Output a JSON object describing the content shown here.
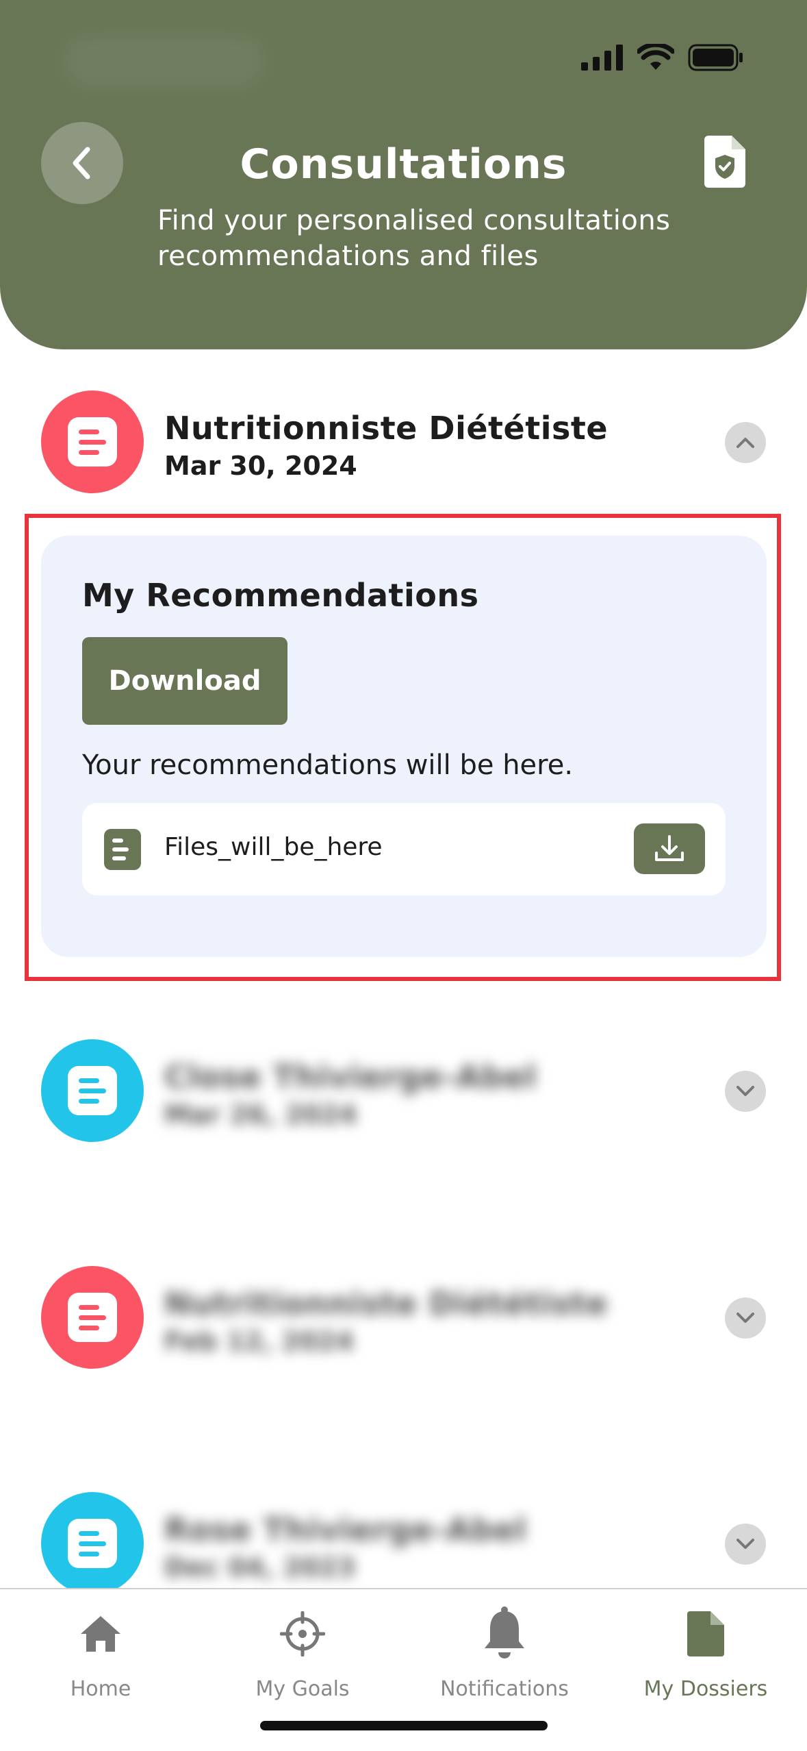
{
  "header": {
    "title": "Consultations",
    "subtitle": "Find your personalised consultations recommendations and files",
    "bg_color": "#687656"
  },
  "consultations": [
    {
      "name": "Nutritionniste Diététiste",
      "date": "Mar 30, 2024",
      "avatar_color": "#fb5565",
      "expanded": true
    },
    {
      "name": "Close Thivierge-Abel",
      "date": "Mar 26, 2024",
      "avatar_color": "#22c4ea",
      "expanded": false,
      "blurred": true
    },
    {
      "name": "Nutritionniste Diététiste",
      "date": "Feb 12, 2024",
      "avatar_color": "#fb5565",
      "expanded": false,
      "blurred": true
    },
    {
      "name": "Rose Thivierge-Abel",
      "date": "Dec 04, 2023",
      "avatar_color": "#22c4ea",
      "expanded": false,
      "blurred": true
    }
  ],
  "recommendations": {
    "title": "My Recommendations",
    "download_label": "Download",
    "description": "Your recommendations will be here.",
    "file_name": "Files_will_be_here"
  },
  "tabbar": {
    "items": [
      {
        "label": "Home",
        "icon": "home-icon"
      },
      {
        "label": "My Goals",
        "icon": "target-icon"
      },
      {
        "label": "Notifications",
        "icon": "bell-icon"
      },
      {
        "label": "My Dossiers",
        "icon": "document-icon",
        "active": true
      }
    ]
  }
}
